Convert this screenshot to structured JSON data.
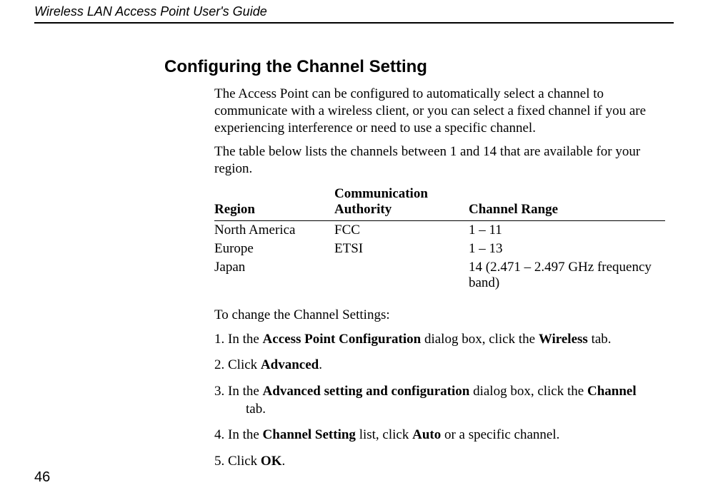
{
  "running_head": "Wireless LAN Access Point User's Guide",
  "page_number": "46",
  "section_title": "Configuring the Channel Setting",
  "intro_para_1": "The Access Point can be configured to automatically select a channel to communicate with a wireless client, or you can select a fixed channel if you are experiencing interference or need to use a specific channel.",
  "intro_para_2": "The table below lists the channels between 1 and 14 that are available for your region.",
  "table": {
    "headers": {
      "region": "Region",
      "authority_line1": "Communication",
      "authority_line2": "Authority",
      "range": "Channel Range"
    },
    "rows": [
      {
        "region": "North America",
        "authority": "FCC",
        "range": "1 – 11"
      },
      {
        "region": "Europe",
        "authority": "ETSI",
        "range": "1 – 13"
      },
      {
        "region": "Japan",
        "authority": "",
        "range": "14 (2.471 – 2.497 GHz frequency band)"
      }
    ]
  },
  "steps_intro": "To change the Channel Settings:",
  "steps": {
    "s1_a": "1. In the ",
    "s1_b": "Access Point Configuration",
    "s1_c": " dialog box, click the ",
    "s1_d": "Wireless",
    "s1_e": " tab.",
    "s2_a": "2. Click ",
    "s2_b": "Advanced",
    "s2_c": ".",
    "s3_a": "3. In the ",
    "s3_b": "Advanced setting and configuration",
    "s3_c": " dialog box, click the ",
    "s3_d": "Channel",
    "s3_e": "tab.",
    "s4_a": "4. In the ",
    "s4_b": "Channel Setting",
    "s4_c": " list, click ",
    "s4_d": "Auto",
    "s4_e": " or a specific channel.",
    "s5_a": "5. Click ",
    "s5_b": "OK",
    "s5_c": "."
  }
}
